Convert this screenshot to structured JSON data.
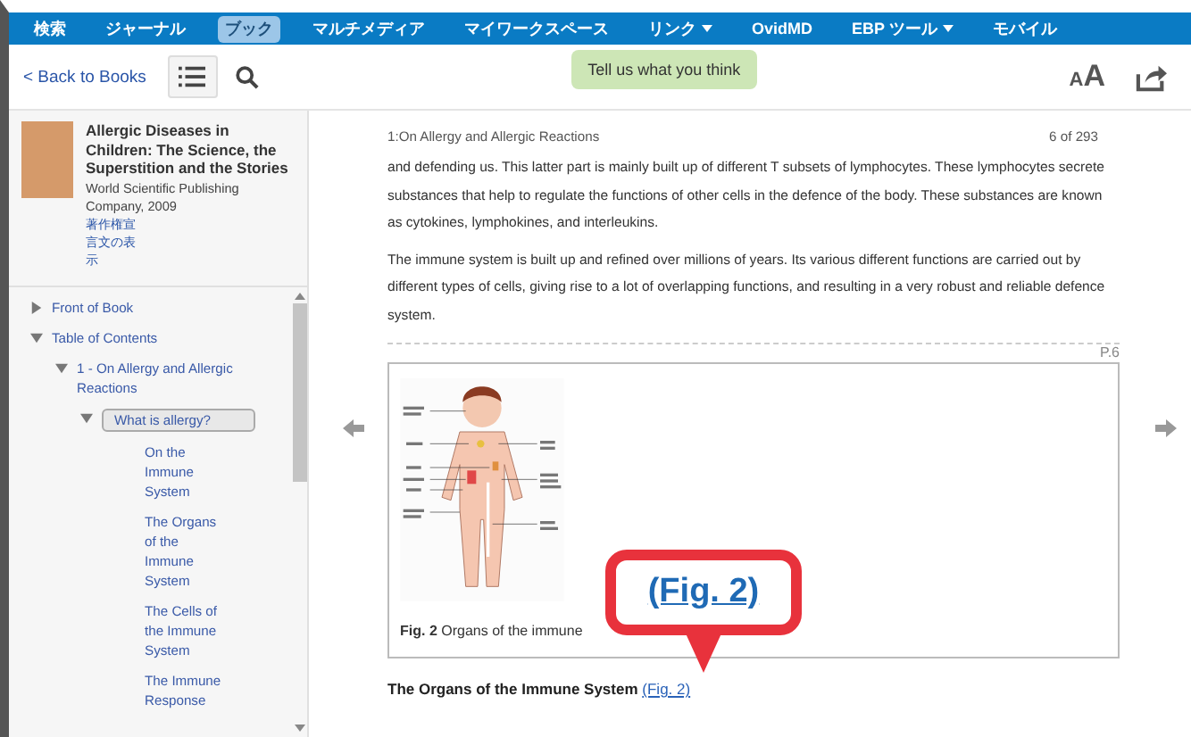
{
  "nav": {
    "items": [
      {
        "label": "検索",
        "selected": false,
        "dropdown": false
      },
      {
        "label": "ジャーナル",
        "selected": false,
        "dropdown": false
      },
      {
        "label": "ブック",
        "selected": true,
        "dropdown": false
      },
      {
        "label": "マルチメディア",
        "selected": false,
        "dropdown": false
      },
      {
        "label": "マイワークスペース",
        "selected": false,
        "dropdown": false
      },
      {
        "label": "リンク",
        "selected": false,
        "dropdown": true
      },
      {
        "label": "OvidMD",
        "selected": false,
        "dropdown": false
      },
      {
        "label": "EBP ツール",
        "selected": false,
        "dropdown": true
      },
      {
        "label": "モバイル",
        "selected": false,
        "dropdown": false
      }
    ]
  },
  "toolbar": {
    "back": "< Back to Books",
    "feedback": "Tell us what you think",
    "font_size": "AA"
  },
  "book": {
    "title": "Allergic Diseases in Children: The Science, the Superstition and the Stories",
    "publisher": "World Scientific Publishing Company, 2009",
    "links": [
      "著作権宣",
      "言文の表",
      "示"
    ]
  },
  "toc": [
    {
      "label": "Front of Book",
      "expanded": false,
      "selected": false
    },
    {
      "label": "Table of Contents",
      "expanded": true,
      "selected": false,
      "children": [
        {
          "label": "1 - On Allergy and Allergic Reactions",
          "expanded": true,
          "selected": false,
          "children": [
            {
              "label": "What is allergy?",
              "expanded": true,
              "selected": true,
              "children": [
                {
                  "label": "On the Immune System",
                  "selected": false
                },
                {
                  "label": "The Organs of the Immune System",
                  "selected": false
                },
                {
                  "label": "The Cells of the Immune System",
                  "selected": false
                },
                {
                  "label": "The Immune Response",
                  "selected": false
                }
              ]
            }
          ]
        }
      ]
    }
  ],
  "content": {
    "chapter": "1:On Allergy and Allergic Reactions",
    "page_count": "6 of 293",
    "paragraphs": [
      "and defending us. This latter part is mainly built up of different T subsets of lymphocytes. These lymphocytes secrete substances that help to regulate the functions of other cells in the defence of the body. These substances are known as cytokines, lymphokines, and interleukins.",
      "The immune system is built up and refined over millions of years. Its various different functions are carried out by different types of cells, giving rise to a lot of overlapping functions, and resulting in a very robust and reliable defence system."
    ],
    "page_marker": "P.6",
    "figure": {
      "caption": "**Fig. 2** Organs of the immune"
    },
    "heading": "The Organs of the Immune System",
    "heading_link": "(Fig. 2)"
  },
  "callout": {
    "text": "(Fig. 2)"
  }
}
